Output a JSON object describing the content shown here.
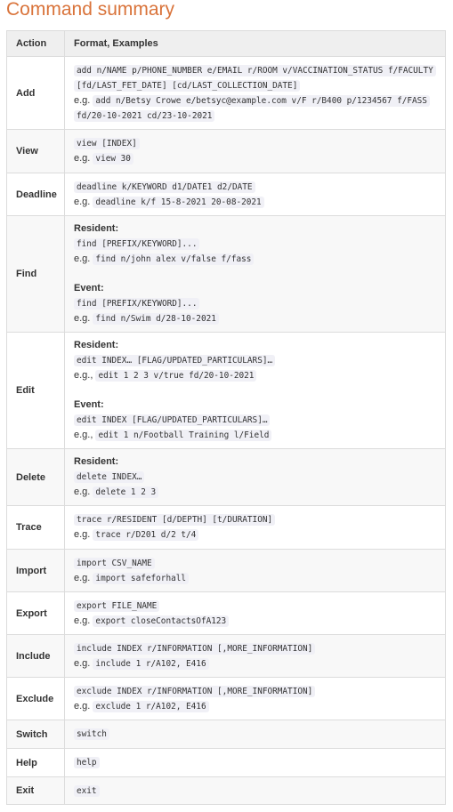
{
  "title": "Command summary",
  "headers": {
    "action": "Action",
    "format": "Format, Examples"
  },
  "rows": [
    {
      "action": "Add",
      "format": [
        "add n/NAME p/PHONE_NUMBER e/EMAIL r/ROOM v/VACCINATION_STATUS f/FACULTY",
        "[fd/LAST_FET_DATE] [cd/LAST_COLLECTION_DATE]"
      ],
      "eg_label": "e.g.",
      "example": [
        "add n/Betsy Crowe e/betsyc@example.com v/F r/B400 p/1234567 f/FASS",
        "fd/20-10-2021 cd/23-10-2021"
      ]
    },
    {
      "action": "View",
      "format": "view [INDEX]",
      "eg_label": "e.g.",
      "example": "view 30"
    },
    {
      "action": "Deadline",
      "format": "deadline k/KEYWORD d1/DATE1 d2/DATE",
      "eg_label": "e.g.",
      "example": "deadline k/f 15-8-2021 20-08-2021"
    },
    {
      "action": "Find",
      "resident_label": "Resident:",
      "resident_format": "find [PREFIX/KEYWORD]...",
      "resident_eg_label": "e.g.",
      "resident_example": "find n/john alex v/false f/fass",
      "event_label": "Event:",
      "event_format": "find [PREFIX/KEYWORD]...",
      "event_eg_label": "e.g.",
      "event_example": "find n/Swim d/28-10-2021"
    },
    {
      "action": "Edit",
      "resident_label": "Resident:",
      "resident_format": "edit INDEX… [FLAG/UPDATED_PARTICULARS]…",
      "resident_eg_label": "e.g.,",
      "resident_example": "edit 1 2 3 v/true fd/20-10-2021",
      "event_label": "Event:",
      "event_format": "edit INDEX [FLAG/UPDATED_PARTICULARS]…",
      "event_eg_label": "e.g.,",
      "event_example": "edit 1 n/Football Training l/Field"
    },
    {
      "action": "Delete",
      "resident_label": "Resident:",
      "resident_format": "delete INDEX…",
      "resident_eg_label": "e.g.",
      "resident_example": "delete 1 2 3"
    },
    {
      "action": "Trace",
      "format": "trace r/RESIDENT [d/DEPTH] [t/DURATION]",
      "eg_label": "e.g.",
      "example": "trace r/D201 d/2 t/4"
    },
    {
      "action": "Import",
      "format": "import CSV_NAME",
      "eg_label": "e.g.",
      "example": "import safeforhall"
    },
    {
      "action": "Export",
      "format": "export FILE_NAME",
      "eg_label": "e.g.",
      "example": "export closeContactsOfA123"
    },
    {
      "action": "Include",
      "format": "include INDEX r/INFORMATION [,MORE_INFORMATION]",
      "eg_label": "e.g.",
      "example": "include 1 r/A102, E416"
    },
    {
      "action": "Exclude",
      "format": "exclude INDEX r/INFORMATION [,MORE_INFORMATION]",
      "eg_label": "e.g.",
      "example": "exclude 1 r/A102, E416"
    },
    {
      "action": "Switch",
      "format": "switch"
    },
    {
      "action": "Help",
      "format": "help"
    },
    {
      "action": "Exit",
      "format": "exit"
    }
  ]
}
